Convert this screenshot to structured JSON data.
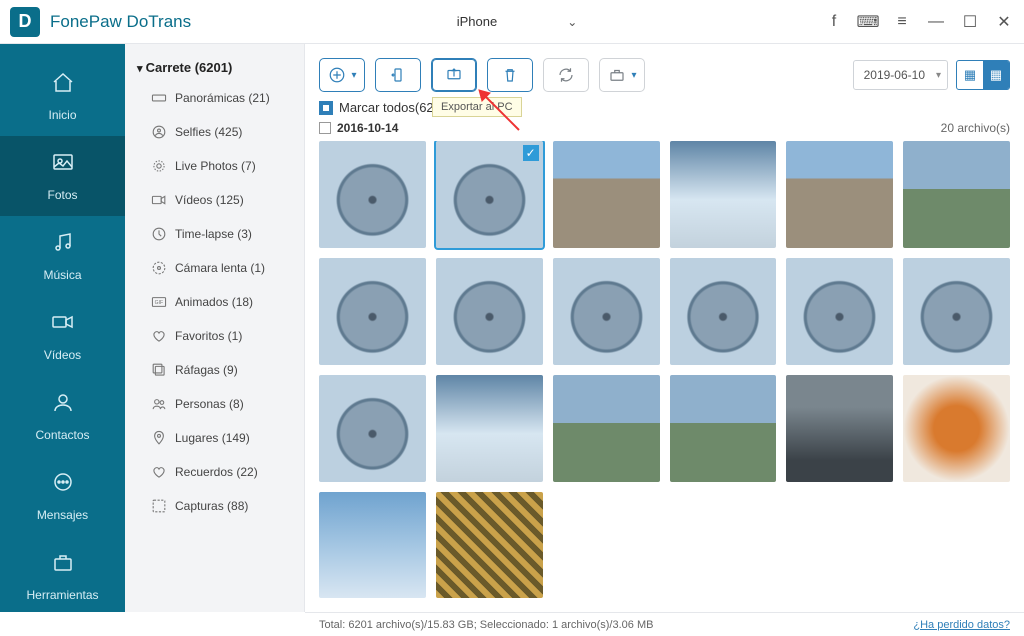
{
  "title": "FonePaw DoTrans",
  "device": "iPhone",
  "sidebar": [
    {
      "key": "inicio",
      "label": "Inicio"
    },
    {
      "key": "fotos",
      "label": "Fotos",
      "active": true
    },
    {
      "key": "musica",
      "label": "Música"
    },
    {
      "key": "videos",
      "label": "Vídeos"
    },
    {
      "key": "contactos",
      "label": "Contactos"
    },
    {
      "key": "mensajes",
      "label": "Mensajes"
    },
    {
      "key": "herramientas",
      "label": "Herramientas"
    }
  ],
  "tree": {
    "head": "Carrete (6201)",
    "items": [
      {
        "icon": "panorama",
        "label": "Panorámicas (21)"
      },
      {
        "icon": "selfie",
        "label": "Selfies (425)"
      },
      {
        "icon": "live",
        "label": "Live Photos (7)"
      },
      {
        "icon": "video",
        "label": "Vídeos (125)"
      },
      {
        "icon": "timelapse",
        "label": "Time-lapse (3)"
      },
      {
        "icon": "slowmo",
        "label": "Cámara lenta (1)"
      },
      {
        "icon": "gif",
        "label": "Animados (18)"
      },
      {
        "icon": "heart",
        "label": "Favoritos (1)"
      },
      {
        "icon": "burst",
        "label": "Ráfagas (9)"
      },
      {
        "icon": "people",
        "label": "Personas (8)"
      },
      {
        "icon": "places",
        "label": "Lugares (149)"
      },
      {
        "icon": "memories",
        "label": "Recuerdos (22)"
      },
      {
        "icon": "capture",
        "label": "Capturas (88)"
      }
    ]
  },
  "tooltip": "Exportar al PC",
  "markall": "Marcar todos(6201)",
  "date": "2016-10-14",
  "filecount": "20 archivo(s)",
  "datepicker": "2019-06-10",
  "thumbs": [
    {
      "c": "th-wheel"
    },
    {
      "c": "th-wheel",
      "sel": true
    },
    {
      "c": "th-church"
    },
    {
      "c": "th-clouds"
    },
    {
      "c": "th-church"
    },
    {
      "c": "th-pan"
    },
    {
      "c": "th-wheel"
    },
    {
      "c": "th-wheel"
    },
    {
      "c": "th-wheel"
    },
    {
      "c": "th-wheel"
    },
    {
      "c": "th-wheel"
    },
    {
      "c": "th-wheel"
    },
    {
      "c": "th-wheel"
    },
    {
      "c": "th-clouds"
    },
    {
      "c": "th-pan"
    },
    {
      "c": "th-pan"
    },
    {
      "c": "th-rail"
    },
    {
      "c": "th-food"
    },
    {
      "c": "th-sky"
    },
    {
      "c": "th-mosaic"
    }
  ],
  "status": {
    "text": "Total: 6201 archivo(s)/15.83 GB; Seleccionado: 1 archivo(s)/3.06 MB",
    "link": "¿Ha perdido datos?"
  }
}
